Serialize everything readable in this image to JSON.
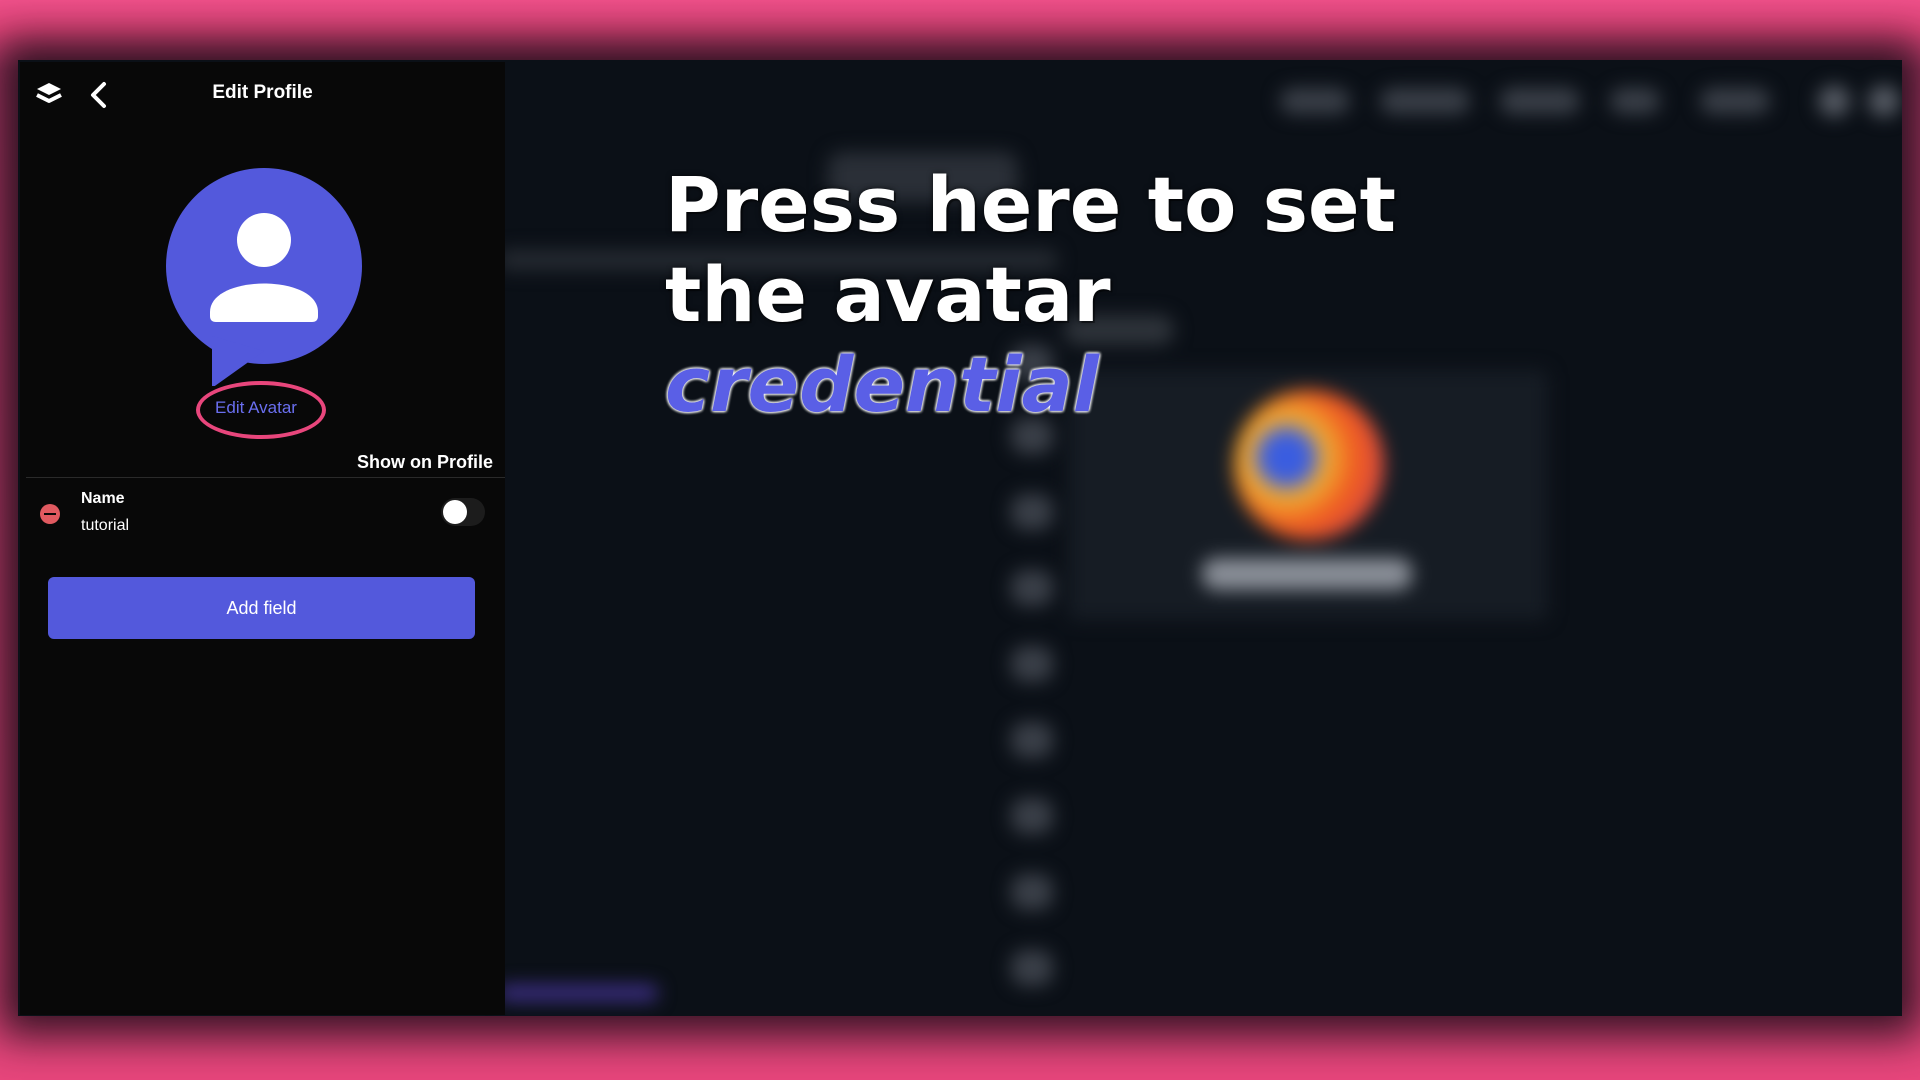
{
  "panel": {
    "title": "Edit Profile",
    "edit_avatar_label": "Edit Avatar",
    "show_on_profile_label": "Show on Profile",
    "fields": [
      {
        "label": "Name",
        "value": "tutorial",
        "show_on_profile": false
      }
    ],
    "add_field_label": "Add field"
  },
  "tooltip": {
    "line1": "Press here to set",
    "line2": "the avatar",
    "accent": "credential"
  },
  "colors": {
    "frame": "#e8467c",
    "accent": "#5359dc",
    "remove": "#e05a60",
    "highlight": "#e8467c"
  }
}
